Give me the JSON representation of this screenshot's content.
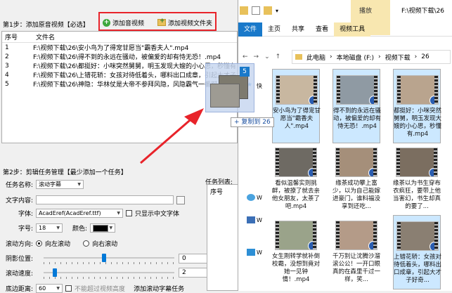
{
  "app": {
    "step1_label": "第1步：添加原音视频【必选】",
    "add_video_btn": "添加音视频",
    "add_folder_btn": "添加视频文件夹",
    "list_headers": [
      "序号",
      "文件名"
    ],
    "rows": [
      {
        "no": "1",
        "name": "F:\\视频下载\\26\\安小鸟为了得宠甘愿当\"霸香夫人\".mp4"
      },
      {
        "no": "2",
        "name": "F:\\视频下载\\26\\得不到的永远在骚动，被偏爱的却有恃无恐！.mp4"
      },
      {
        "no": "3",
        "name": "F:\\视频下载\\26\\都挺好：小咪突然舅舅，明玉发现大嫂的小心思，秒懂有"
      },
      {
        "no": "4",
        "name": "F:\\视频下载\\26\\上错花轿：女孩对待低着头，哪料出口成章，引起大才子"
      },
      {
        "no": "5",
        "name": "F:\\视频下载\\26\\神隐：华林仗是大帝不参拜风隐，风隐霸气一番怼"
      }
    ],
    "step2_label": "第2步：剪辑任务管理【最少添加一个任务】",
    "task_name_label": "任务名称:",
    "task_name_value": "滚动字幕",
    "text_content_label": "文字内容:",
    "font_label": "字体:",
    "font_value": "AcadEref(AcadEref.ttf)",
    "cn_only_label": "只显示中文字体",
    "size_label": "字号:",
    "size_value": "18",
    "color_label": "颜色:",
    "direction_label": "滚动方向:",
    "dir_left": "向左滚动",
    "dir_right": "向右滚动",
    "shadow_label": "阴影位置:",
    "shadow_value": "0",
    "shadow_level": 0.46,
    "speed_label": "滚动速度:",
    "speed_value": "2",
    "speed_level": 0.07,
    "bottom_label": "底边距离:",
    "bottom_value": "60",
    "truncated_label": "不能超过视频高度",
    "add_task_label": "添加滚动字幕任务",
    "task_list_label": "任务列表:",
    "task_seq_header": "序号"
  },
  "explorer": {
    "play_tab": "播放",
    "title_path": "F:\\视频下载\\26",
    "tabs": [
      "文件",
      "主页",
      "共享",
      "查看",
      "视频工具"
    ],
    "breadcrumb": [
      "此电脑",
      "本地磁盘 (F:)",
      "视频下载",
      "26"
    ],
    "nav_items": [
      "快",
      "W",
      "W",
      "W"
    ],
    "files": [
      {
        "caption": "安小鸟为了得宠甘愿当\"霸香夫人\".mp4",
        "selected": true
      },
      {
        "caption": "得不到的永远在骚动，被偏爱的却有恃无恐！.mp4",
        "selected": true
      },
      {
        "caption": "都挺好：小咪突然舅舅，明玉发现大嫂的小心思，秒懂有.mp4",
        "selected": true
      },
      {
        "caption": "看似温馨实则挑衅，被撩了就去亲他女朋友，太茶了吧.mp4",
        "selected": false
      },
      {
        "caption": "缘茶成功攀上富少，以为自己能嫁进豪门，谁料福没享到还吃...",
        "selected": false
      },
      {
        "caption": "缘茶以为书生穿布衣疯狂，要带上他当害幻，书生却真的要了...",
        "selected": false
      },
      {
        "caption": "女生刚转学就补倒校霸，没想到竟对她一见钟情！.mp4",
        "selected": false
      },
      {
        "caption": "千万别让沈腾沙溜滚公公！一开口眼真的在森里千过一样，笑...",
        "selected": false
      },
      {
        "caption": "上错花轿：女孩对待低着头，哪料出口成章，引起大才子好奇...",
        "selected": true
      }
    ],
    "drag_count": "5",
    "copy_tip": "+ 复制到 26"
  },
  "colors": {
    "accent": "#1979ca",
    "highlight_box": "#e8232a",
    "selection": "#cce8ff",
    "play_tab": "#f8e7b0"
  }
}
